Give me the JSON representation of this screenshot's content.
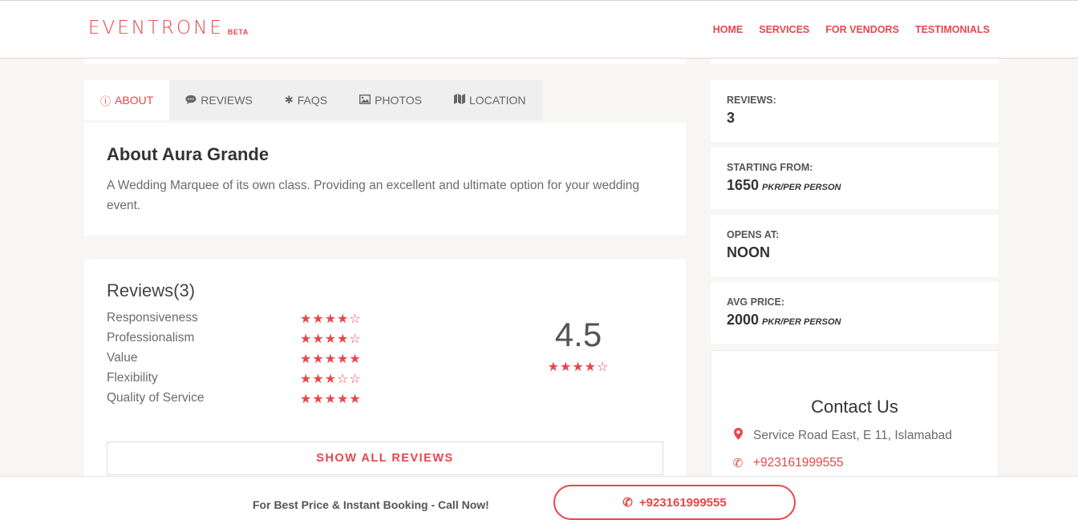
{
  "brand": {
    "name": "EVENTRONE",
    "badge": "BETA"
  },
  "nav": [
    "HOME",
    "SERVICES",
    "FOR VENDORS",
    "TESTIMONIALS"
  ],
  "tabs": [
    {
      "label": "ABOUT",
      "icon": "info-circle-icon"
    },
    {
      "label": "REVIEWS",
      "icon": "comment-icon"
    },
    {
      "label": "FAQS",
      "icon": "asterisk-icon"
    },
    {
      "label": "PHOTOS",
      "icon": "image-icon"
    },
    {
      "label": "LOCATION",
      "icon": "map-icon"
    }
  ],
  "about": {
    "title": "About Aura Grande",
    "text": "A Wedding Marquee of its own class. Providing an excellent and ultimate option for your wedding event."
  },
  "reviews": {
    "title": "Reviews(3)",
    "criteria": [
      {
        "label": "Responsiveness",
        "rating": 4
      },
      {
        "label": "Professionalism",
        "rating": 4
      },
      {
        "label": "Value",
        "rating": 5
      },
      {
        "label": "Flexibility",
        "rating": 3
      },
      {
        "label": "Quality of Service",
        "rating": 5
      }
    ],
    "overall": "4.5",
    "overall_stars": 4,
    "show_all": "SHOW ALL REVIEWS"
  },
  "sidebar": {
    "reviews": {
      "label": "REVIEWS:",
      "value": "3"
    },
    "starting_from": {
      "label": "STARTING FROM:",
      "value": "1650",
      "unit": "PKR/PER PERSON"
    },
    "opens_at": {
      "label": "OPENS AT:",
      "value": "NOON"
    },
    "avg_price": {
      "label": "AVG PRICE:",
      "value": "2000",
      "unit": "PKR/PER PERSON"
    }
  },
  "contact": {
    "title": "Contact Us",
    "address": "Service Road East, E 11, Islamabad",
    "phone": "+923161999555"
  },
  "bottom_bar": {
    "text": "For Best Price & Instant Booking - Call Now!",
    "phone": "+923161999555"
  },
  "colors": {
    "accent": "#e8464a"
  }
}
